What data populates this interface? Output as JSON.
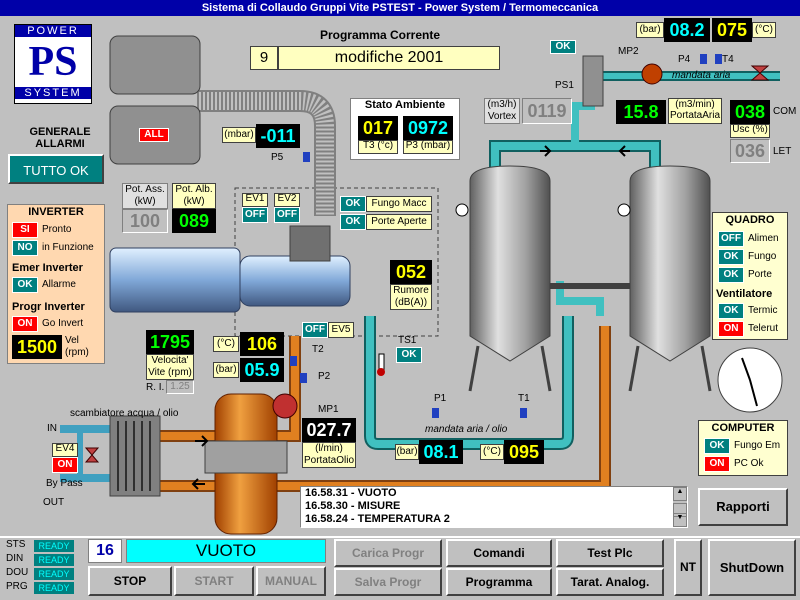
{
  "window": {
    "title": "Sistema di Collaudo Gruppi Vite PSTEST - Power System / Termomeccanica"
  },
  "logo": {
    "top": "POWER",
    "mid": "PS",
    "bottom": "SYSTEM"
  },
  "alarms": {
    "title1": "GENERALE",
    "title2": "ALLARMI",
    "status": "TUTTO OK",
    "all_badge": "ALL"
  },
  "program": {
    "title": "Programma Corrente",
    "number": "9",
    "name": "modifiche 2001"
  },
  "stato_ambiente": {
    "title": "Stato Ambiente",
    "t3": "017",
    "t3_label": "T3 (°c)",
    "p3": "0972",
    "p3_label": "P3 (mbar)"
  },
  "vortex": {
    "label1": "(m3/h)",
    "label2": "Vortex",
    "value": "0119"
  },
  "mbar_p5": {
    "unit": "(mbar)",
    "value": "-011",
    "tag": "P5"
  },
  "top_right": {
    "bar_unit": "(bar)",
    "bar_value": "08.2",
    "temp_value": "075",
    "temp_unit": "(°C)",
    "ok": "OK",
    "mp2": "MP2",
    "p4": "P4",
    "t4": "T4",
    "ps1": "PS1",
    "mandata_aria": "mandata aria",
    "flow_value": "15.8",
    "flow_unit": "(m3/min)",
    "flow_label": "PortataAria",
    "com_value": "038",
    "com_label": "COM",
    "usc_label": "Usc (%)",
    "let_value": "036",
    "let_label": "LET"
  },
  "power": {
    "ass_label": "Pot. Ass. (kW)",
    "ass_value": "100",
    "alb_label": "Pot. Alb. (kW)",
    "alb_value": "089"
  },
  "ev": {
    "ev1": "EV1",
    "ev1_state": "OFF",
    "ev2": "EV2",
    "ev2_state": "OFF",
    "ev5_state": "OFF",
    "ev5": "EV5",
    "ev4": "EV4",
    "ev4_state": "ON"
  },
  "fungo": {
    "macc_state": "OK",
    "macc_label": "Fungo Macc",
    "porte_state": "OK",
    "porte_label": "Porte Aperte"
  },
  "rumore": {
    "value": "052",
    "label": "Rumore (dB(A))"
  },
  "inverter": {
    "title": "INVERTER",
    "si": "SI",
    "pronto": "Pronto",
    "no": "NO",
    "in_funzione": "in Funzione",
    "emer_title": "Emer Inverter",
    "emer_state": "OK",
    "emer_label": "Allarme",
    "progr_title": "Progr Inverter",
    "progr_state": "ON",
    "progr_label": "Go Invert",
    "vel_value": "1500",
    "vel_label": "Vel (rpm)"
  },
  "velocita": {
    "value": "1795",
    "label": "Velocita' Vite (rpm)",
    "ri_label": "R. I.",
    "ri_value": "1.25"
  },
  "oil": {
    "t_unit": "(°C)",
    "t_value": "106",
    "t_tag": "T2",
    "p_unit": "(bar)",
    "p_value": "05.9",
    "p_tag": "P2",
    "mp1": "MP1",
    "flow_value": "027.7",
    "flow_unit": "(l/min)",
    "flow_label": "PortataOlio"
  },
  "ts1": {
    "label": "TS1",
    "state": "OK"
  },
  "mandata_aria_olio": {
    "label": "mandata aria / olio",
    "p1": "P1",
    "t1": "T1",
    "bar_unit": "(bar)",
    "bar_value": "08.1",
    "temp_unit": "(°C)",
    "temp_value": "095"
  },
  "scambiatore": {
    "label": "scambiatore acqua / olio",
    "in": "IN",
    "out": "OUT",
    "bypass": "By Pass"
  },
  "quadro": {
    "title": "QUADRO",
    "alimen_state": "OFF",
    "alimen": "Alimen",
    "fungo_state": "OK",
    "fungo": "Fungo",
    "porte_state": "OK",
    "porte": "Porte",
    "vent_title": "Ventilatore",
    "termic_state": "OK",
    "termic": "Termic",
    "telerut_state": "ON",
    "telerut": "Telerut"
  },
  "computer": {
    "title": "COMPUTER",
    "fungo_state": "OK",
    "fungo": "Fungo Em",
    "pc_state": "ON",
    "pc": "PC Ok"
  },
  "log": {
    "lines": [
      "16.58.31 - VUOTO",
      "16.58.30 - MISURE",
      "16.58.24 - TEMPERATURA 2"
    ]
  },
  "rapporti": {
    "label": "Rapporti"
  },
  "status": {
    "sts": "STS",
    "sts_v": "READY",
    "din": "DIN",
    "din_v": "READY",
    "dou": "DOU",
    "dou_v": "READY",
    "prg": "PRG",
    "prg_v": "READY"
  },
  "phase": {
    "number": "16",
    "name": "VUOTO"
  },
  "buttons": {
    "stop": "STOP",
    "start": "START",
    "manual": "MANUAL",
    "carica": "Carica Progr",
    "salva": "Salva Progr",
    "comandi": "Comandi",
    "programma": "Programma",
    "testplc": "Test Plc",
    "tarat": "Tarat. Analog.",
    "nt": "NT",
    "shutdown": "ShutDown"
  },
  "colors": {
    "pipe_oil": "#e08020",
    "pipe_air": "#40c0c0",
    "title_bg": "#0000a8"
  }
}
